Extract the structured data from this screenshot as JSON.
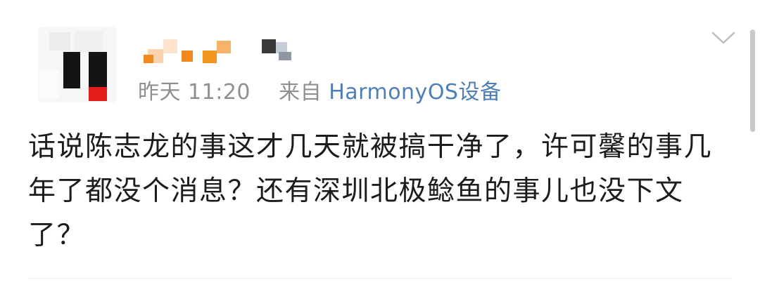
{
  "post": {
    "time": "昨天 11:20",
    "from_label": "来自",
    "source": "HarmonyOS设备",
    "content": "话说陈志龙的事这才几天就被搞干净了，许可馨的事几年了都没个消息？还有深圳北极鲶鱼的事儿也没下文了？"
  },
  "icons": {
    "dropdown": "chevron-down-icon"
  },
  "colors": {
    "meta_text": "#8f8f8f",
    "source_link": "#4e7fb6",
    "body_text": "#1c1c1c",
    "mosaic_orange": "#f08a1e"
  }
}
